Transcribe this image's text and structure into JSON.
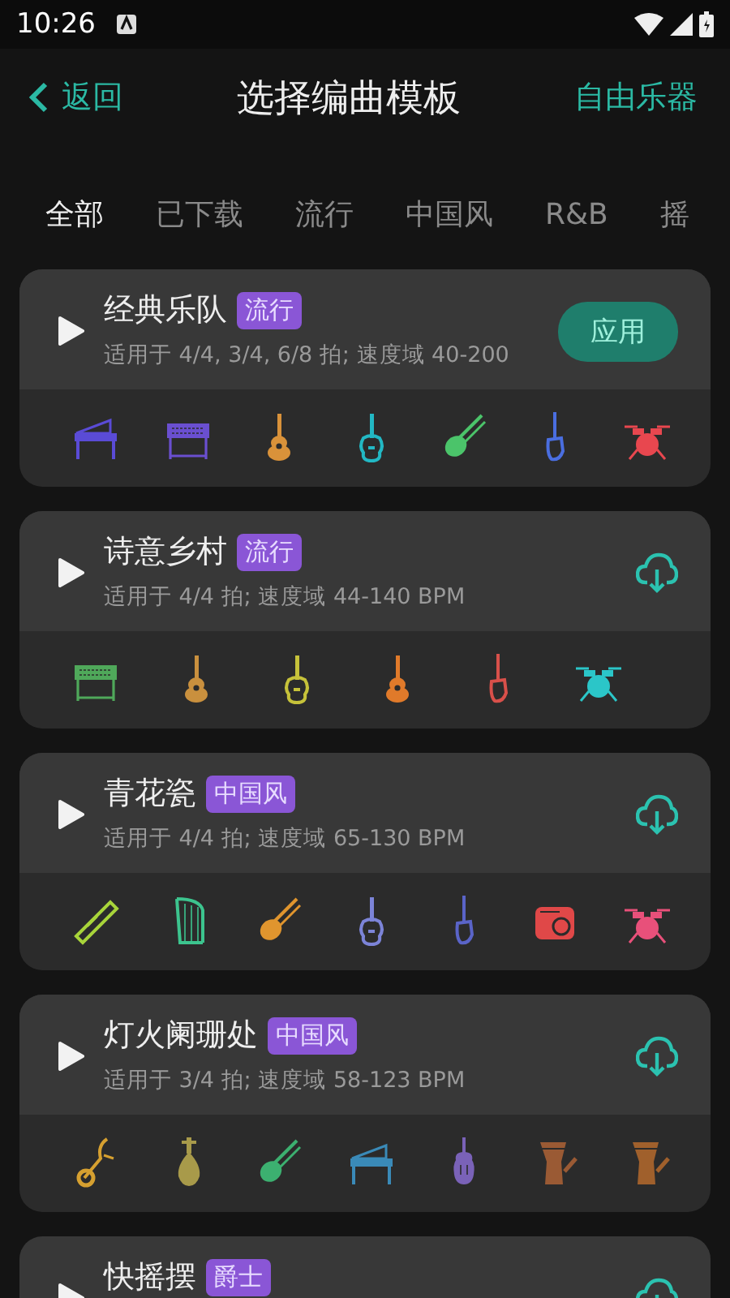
{
  "status_bar": {
    "time": "10:26"
  },
  "header": {
    "back": "返回",
    "title": "选择编曲模板",
    "action": "自由乐器"
  },
  "tabs": [
    {
      "label": "全部",
      "selected": true
    },
    {
      "label": "已下载",
      "selected": false
    },
    {
      "label": "流行",
      "selected": false
    },
    {
      "label": "中国风",
      "selected": false
    },
    {
      "label": "R&B",
      "selected": false
    },
    {
      "label": "摇",
      "selected": false
    }
  ],
  "templates": [
    {
      "name": "经典乐队",
      "tag": "流行",
      "description": "适用于 4/4, 3/4, 6/8 拍; 速度域 40-200",
      "action": {
        "kind": "apply",
        "label": "应用"
      },
      "instruments": [
        {
          "kind": "piano",
          "color": "#5a4bd6"
        },
        {
          "kind": "keyboard",
          "color": "#6a4fd0"
        },
        {
          "kind": "guitar",
          "color": "#d9923a"
        },
        {
          "kind": "electric-guitar",
          "color": "#22b8c4"
        },
        {
          "kind": "violin",
          "color": "#4bc46a"
        },
        {
          "kind": "bass",
          "color": "#4a6ee0"
        },
        {
          "kind": "drums",
          "color": "#e8474f"
        }
      ]
    },
    {
      "name": "诗意乡村",
      "tag": "流行",
      "description": "适用于 4/4 拍; 速度域 44-140 BPM",
      "action": {
        "kind": "download"
      },
      "instruments": [
        {
          "kind": "keyboard",
          "color": "#4fa85a"
        },
        {
          "kind": "guitar",
          "color": "#c9903e"
        },
        {
          "kind": "electric-guitar",
          "color": "#c6c23a"
        },
        {
          "kind": "guitar",
          "color": "#e07a2a"
        },
        {
          "kind": "bass",
          "color": "#d8504a"
        },
        {
          "kind": "drums",
          "color": "#2bc6c8"
        }
      ]
    },
    {
      "name": "青花瓷",
      "tag": "中国风",
      "description": "适用于 4/4 拍; 速度域 65-130 BPM",
      "action": {
        "kind": "download"
      },
      "instruments": [
        {
          "kind": "flute",
          "color": "#a8d43a"
        },
        {
          "kind": "harp",
          "color": "#3cc48e"
        },
        {
          "kind": "violin",
          "color": "#e0952e"
        },
        {
          "kind": "electric-guitar",
          "color": "#7c84d8"
        },
        {
          "kind": "bass",
          "color": "#5a64c8"
        },
        {
          "kind": "amp",
          "color": "#e04848"
        },
        {
          "kind": "drums",
          "color": "#e8507a"
        }
      ]
    },
    {
      "name": "灯火阑珊处",
      "tag": "中国风",
      "description": "适用于 3/4 拍; 速度域 58-123 BPM",
      "action": {
        "kind": "download"
      },
      "instruments": [
        {
          "kind": "erhu",
          "color": "#d6a030"
        },
        {
          "kind": "pipa",
          "color": "#a89a4a"
        },
        {
          "kind": "violin",
          "color": "#3cb070"
        },
        {
          "kind": "piano",
          "color": "#3a8ab8"
        },
        {
          "kind": "cello",
          "color": "#7a62b8"
        },
        {
          "kind": "hand-drum",
          "color": "#9a5a34"
        },
        {
          "kind": "hand-drum",
          "color": "#a0602c"
        }
      ]
    },
    {
      "name": "快摇摆",
      "tag": "爵士",
      "action": {
        "kind": "download"
      }
    }
  ]
}
